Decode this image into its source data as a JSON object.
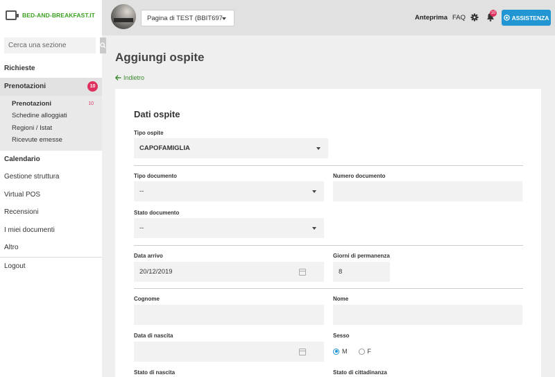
{
  "app": {
    "logo_text": "BED-AND-BREAKFAST.IT",
    "brand_color": "#3aa11f",
    "accent_color": "#2196d3",
    "badge_color": "#e0315e"
  },
  "sidebar": {
    "search_placeholder": "Cerca una sezione",
    "items": [
      {
        "label": "Richieste"
      },
      {
        "label": "Prenotazioni",
        "badge": "10"
      },
      {
        "label": "Calendario"
      },
      {
        "label": "Gestione struttura"
      },
      {
        "label": "Virtual POS"
      },
      {
        "label": "Recensioni"
      },
      {
        "label": "I miei documenti"
      },
      {
        "label": "Altro"
      },
      {
        "label": "Logout"
      }
    ],
    "subitems": [
      {
        "label": "Prenotazioni",
        "count": "10"
      },
      {
        "label": "Schedine alloggiati"
      },
      {
        "label": "Regioni / Istat"
      },
      {
        "label": "Ricevute emesse"
      }
    ]
  },
  "header": {
    "property_select": "Pagina di TEST (BBIT697",
    "preview": "Anteprima",
    "faq": "FAQ",
    "notif_count": "10",
    "assist": "ASSISTENZA"
  },
  "main": {
    "title": "Aggiungi ospite",
    "back": "Indietro",
    "card_title": "Dati ospite"
  },
  "form": {
    "tipo_ospite_label": "Tipo ospite",
    "tipo_ospite_value": "CAPOFAMIGLIA",
    "tipo_documento_label": "Tipo documento",
    "tipo_documento_value": "--",
    "numero_documento_label": "Numero documento",
    "stato_documento_label": "Stato documento",
    "stato_documento_value": "--",
    "data_arrivo_label": "Data arrivo",
    "data_arrivo_value": "20/12/2019",
    "giorni_label": "Giorni di permanenza",
    "giorni_value": "8",
    "cognome_label": "Cognome",
    "nome_label": "Nome",
    "data_nascita_label": "Data di nascita",
    "sesso_label": "Sesso",
    "sesso_m": "M",
    "sesso_f": "F",
    "sesso_selected": "M",
    "stato_nascita_label": "Stato di nascita",
    "stato_cittadinanza_label": "Stato di cittadinanza"
  }
}
